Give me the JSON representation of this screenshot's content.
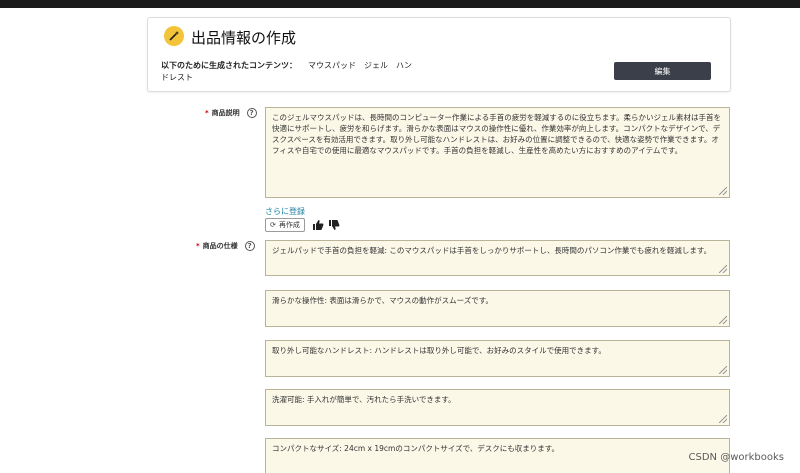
{
  "header": {
    "title": "出品情報の作成",
    "generated_for_label": "以下のために生成されたコンテンツ：",
    "generated_for_value_line1": "マウスパッド　ジェル　ハン",
    "generated_for_value_line2": "ドレスト",
    "edit_button_label": "編集"
  },
  "description": {
    "label": "商品説明",
    "required_mark": "*",
    "text": "このジェルマウスパッドは、長時間のコンピューター作業による手首の疲労を軽減するのに役立ちます。柔らかいジェル素材は手首を快適にサポートし、疲労を和らげます。滑らかな表面はマウスの操作性に優れ、作業効率が向上します。コンパクトなデザインで、デスクスペースを有効活用できます。取り外し可能なハンドレストは、お好みの位置に調整できるので、快適な姿勢で作業できます。オフィスや自宅での使用に最適なマウスパッドです。手首の負担を軽減し、生産性を高めたい方におすすめのアイテムです。",
    "more_link": "さらに登録",
    "regenerate_label": "再作成"
  },
  "specs": {
    "label": "商品の仕様",
    "required_mark": "*",
    "items": [
      "ジェルパッドで手首の負担を軽減: このマウスパッドは手首をしっかりサポートし、長時間のパソコン作業でも疲れを軽減します。",
      "滑らかな操作性: 表面は滑らかで、マウスの動作がスムーズです。",
      "取り外し可能なハンドレスト: ハンドレストは取り外し可能で、お好みのスタイルで使用できます。",
      "洗濯可能: 手入れが簡単で、汚れたら手洗いできます。",
      "コンパクトなサイズ: 24cm x 19cmのコンパクトサイズで、デスクにも収まります。"
    ]
  },
  "watermark": "CSDN @workbooks",
  "colors": {
    "textbox_bg": "#fbf8e8",
    "button_bg": "#3a3f4a",
    "link": "#1a7fa0"
  }
}
